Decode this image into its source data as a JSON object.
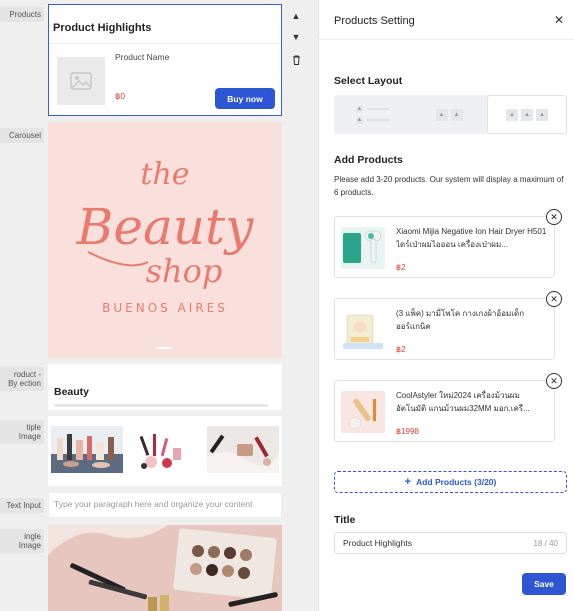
{
  "sidebar_labels": {
    "products": "Products",
    "carousel": "Carousel",
    "product_by_section": "roduct - By ection",
    "multiple_image": "tiple Image",
    "text_input": "Text Input",
    "single_image": "ingle Image"
  },
  "canvas": {
    "product_highlights": {
      "title": "Product Highlights",
      "product_name": "Product Name",
      "price": "฿0",
      "buy_label": "Buy now"
    },
    "carousel": {
      "logo_line1": "the",
      "logo_line2": "Beauty",
      "logo_line3": "shop",
      "logo_line4": "BUENOS AIRES"
    },
    "section_title": "Beauty",
    "text_input_placeholder": "Type your paragraph here and organize your content",
    "controls": {
      "up_icon": "caret-up-icon",
      "down_icon": "caret-down-icon",
      "delete_icon": "trash-icon"
    }
  },
  "panel": {
    "title": "Products Setting",
    "select_layout_label": "Select Layout",
    "add_products_label": "Add Products",
    "hint": "Please add 3-20 products. Our system will display a maximum of 6 products.",
    "products": [
      {
        "name": "Xiaomi Mijia Negative Ion Hair Dryer H501 ไดร์เป่าผมไอออน เครื่องเป่าผม...",
        "price": "฿2"
      },
      {
        "name": "(3 แพ็ค) มามี่โพโค กางเกงผ้าอ้อมเด็ก ออร์แกนิค",
        "price": "฿2"
      },
      {
        "name": "CoolAstyler ใหม่2024 เครื่องม้วนผม อัตโนมัติ แกนม้วนผม32MM มอก.เครื...",
        "price": "฿1998"
      }
    ],
    "add_products_button": "Add Products (3/20)",
    "title_label": "Title",
    "title_value": "Product Highlights",
    "title_count": "18 / 40",
    "save_label": "Save"
  },
  "colors": {
    "accent": "#2e56d4",
    "price": "#e53935",
    "carousel_bg": "#f9e0dd",
    "logo": "#ea7a6c"
  }
}
